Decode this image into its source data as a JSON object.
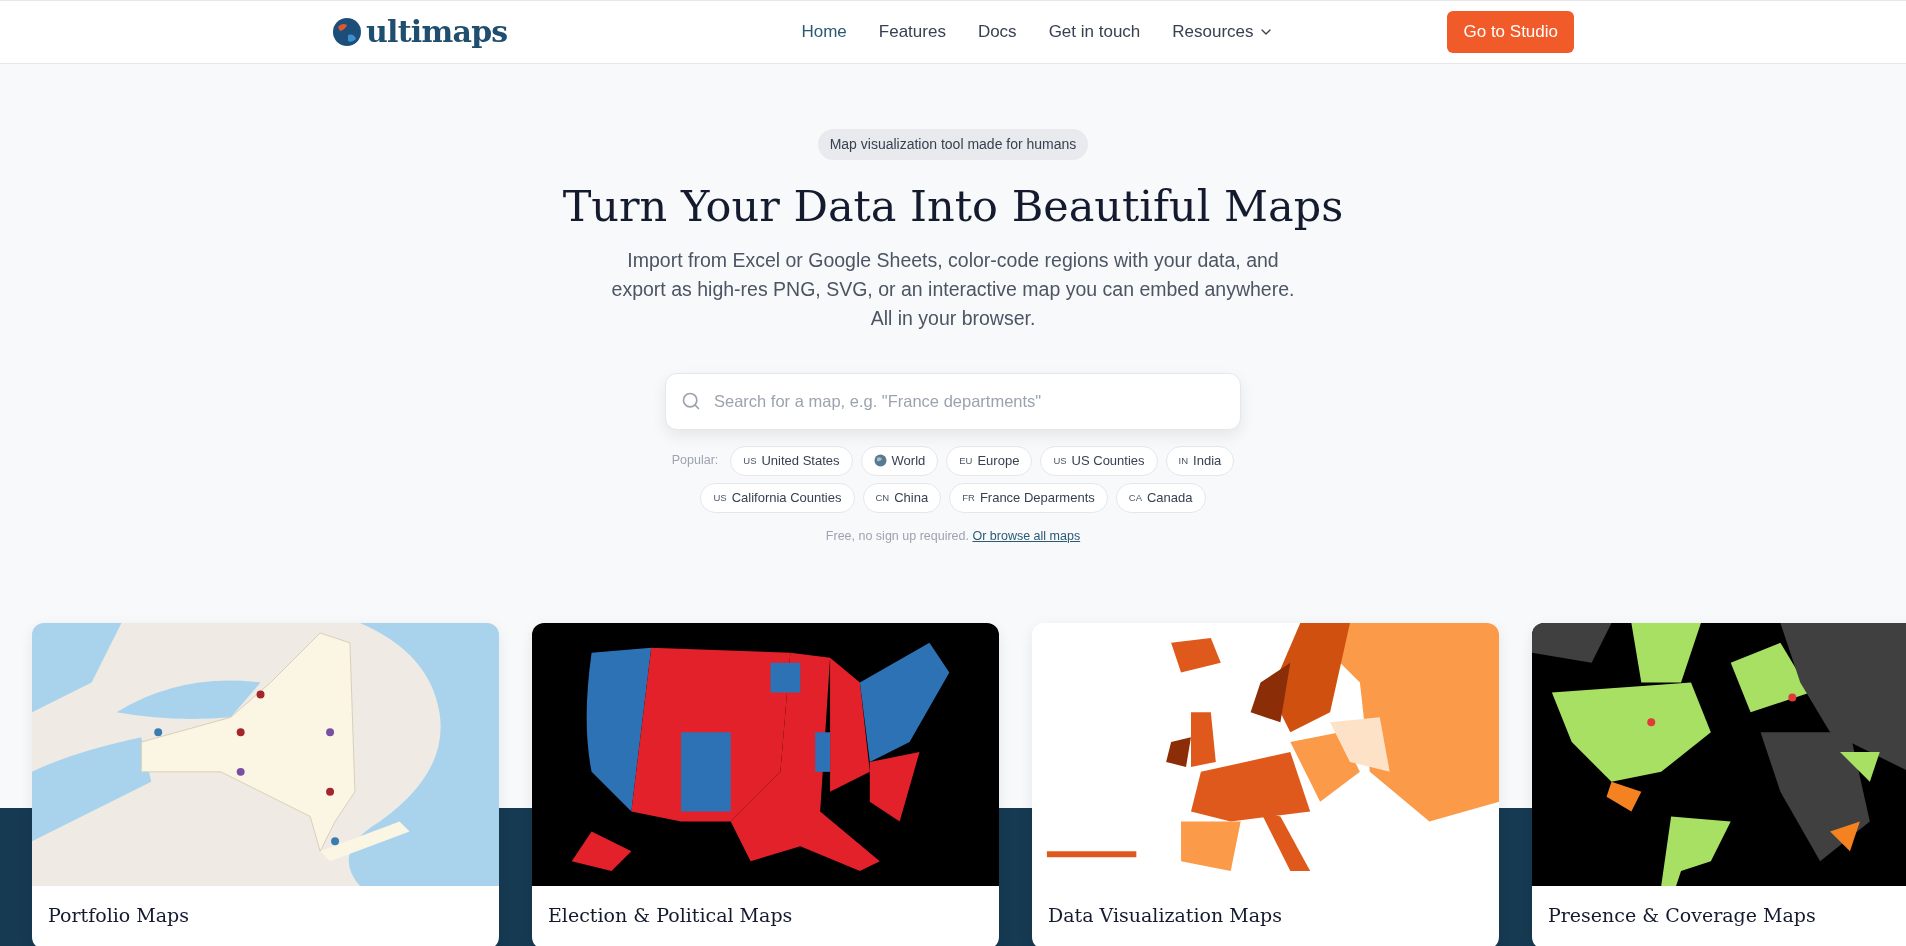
{
  "header": {
    "logo": "ultimaps",
    "nav": [
      {
        "label": "Home",
        "selected": true,
        "dropdown": false
      },
      {
        "label": "Features",
        "selected": false,
        "dropdown": false
      },
      {
        "label": "Docs",
        "selected": false,
        "dropdown": false
      },
      {
        "label": "Get in touch",
        "selected": false,
        "dropdown": false
      },
      {
        "label": "Resources",
        "selected": false,
        "dropdown": true
      }
    ],
    "cta": "Go to Studio"
  },
  "hero": {
    "badge": "Map visualization tool made for humans",
    "title": "Turn Your Data Into Beautiful Maps",
    "lines": [
      "Import from Excel or Google Sheets, color-code regions with your data, and",
      "export as high-res PNG, SVG, or an interactive map you can embed anywhere.",
      "All in your browser."
    ],
    "search": {
      "placeholder": "Search for a map, e.g. \"France departments\""
    },
    "popular_label": "Popular:",
    "chips": [
      [
        {
          "kind": "code",
          "code": "US",
          "label": "United States"
        },
        {
          "kind": "globe",
          "label": "World"
        },
        {
          "kind": "code",
          "code": "EU",
          "label": "Europe"
        },
        {
          "kind": "code",
          "code": "US",
          "label": "US Counties"
        },
        {
          "kind": "code",
          "code": "IN",
          "label": "India"
        }
      ],
      [
        {
          "kind": "code",
          "code": "US",
          "label": "California Counties"
        },
        {
          "kind": "code",
          "code": "CN",
          "label": "China"
        },
        {
          "kind": "code",
          "code": "FR",
          "label": "France Deparments"
        },
        {
          "kind": "code",
          "code": "CA",
          "label": "Canada"
        }
      ]
    ],
    "note": "Free, no sign up required.",
    "link": "Or browse all maps"
  },
  "cards": [
    {
      "title": "Portfolio Maps",
      "kind": "picture"
    },
    {
      "title": "Election & Political Maps",
      "kind": "picture"
    },
    {
      "title": "Data Visualization Maps",
      "kind": "picture"
    },
    {
      "title": "Presence & Coverage Maps",
      "kind": "picture"
    }
  ]
}
